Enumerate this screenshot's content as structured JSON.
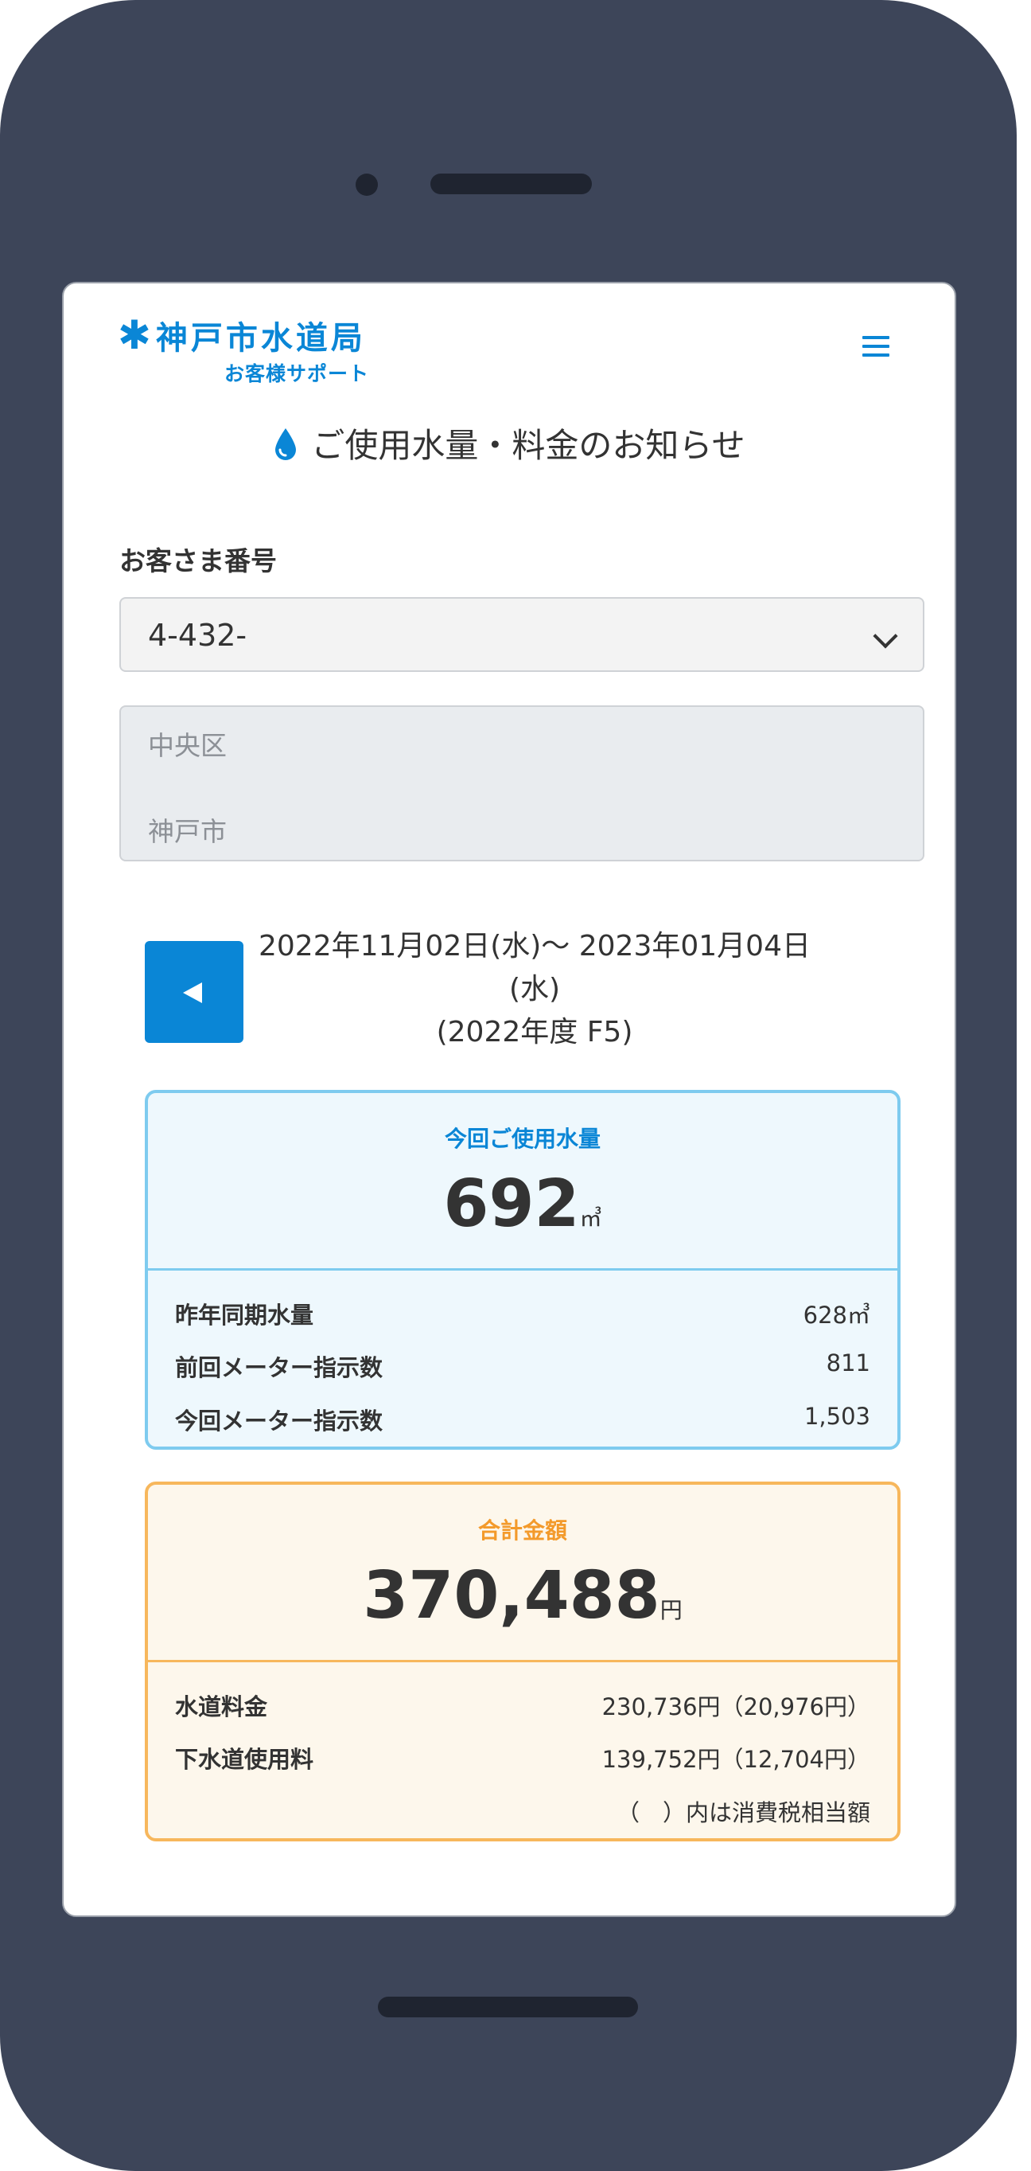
{
  "header": {
    "logo_mark": "✱",
    "logo_title": "神戸市水道局",
    "logo_subtitle": "お客様サポート",
    "menu_icon": "hamburger-menu-icon"
  },
  "page_title": "ご使用水量・料金のお知らせ",
  "customer": {
    "label": "お客さま番号",
    "selected_value": "4-432-",
    "address_line1": "中央区",
    "address_line2": "神戸市"
  },
  "period": {
    "line1": "2022年11月02日(水)〜 2023年01月04日",
    "line2": "(水)",
    "line3": "(2022年度 F5)"
  },
  "usage": {
    "label": "今回ご使用水量",
    "value": "692",
    "unit": "㎥",
    "rows": [
      {
        "key": "昨年同期水量",
        "value": "628㎥"
      },
      {
        "key": "前回メーター指示数",
        "value": "811"
      },
      {
        "key": "今回メーター指示数",
        "value": "1,503"
      }
    ]
  },
  "total": {
    "label": "合計金額",
    "value": "370,488",
    "unit": "円",
    "rows": [
      {
        "key": "水道料金",
        "value": "230,736円（20,976円）"
      },
      {
        "key": "下水道使用料",
        "value": "139,752円（12,704円）"
      }
    ],
    "note": "（　）内は消費税相当額"
  },
  "colors": {
    "accent": "#0a86d6",
    "usage_border": "#7ecbef",
    "total_border": "#f7b75c",
    "total_label": "#f39a2b",
    "phone_frame": "#3d4559"
  }
}
